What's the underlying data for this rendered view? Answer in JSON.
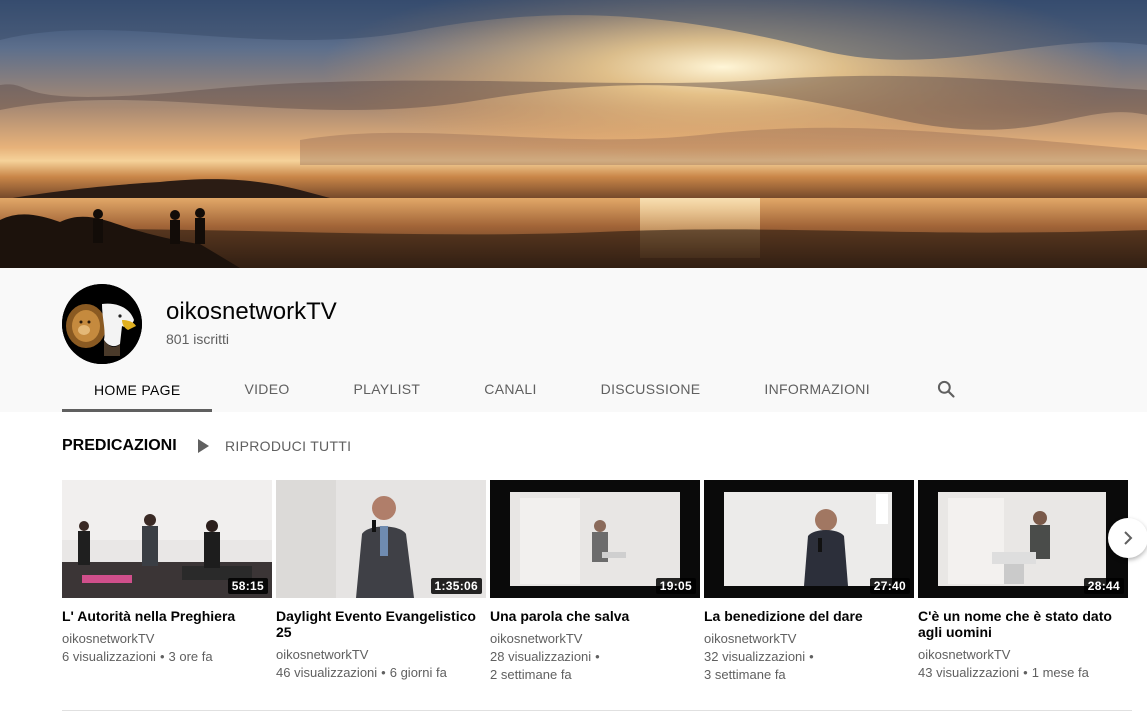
{
  "channel": {
    "name": "oikosnetworkTV",
    "subscribers": "801 iscritti"
  },
  "tabs": [
    {
      "label": "HOME PAGE"
    },
    {
      "label": "VIDEO"
    },
    {
      "label": "PLAYLIST"
    },
    {
      "label": "CANALI"
    },
    {
      "label": "DISCUSSIONE"
    },
    {
      "label": "INFORMAZIONI"
    }
  ],
  "active_tab": "HOME PAGE",
  "section": {
    "title": "PREDICAZIONI",
    "play_all": "RIPRODUCI TUTTI"
  },
  "videos": [
    {
      "title": "L' Autorità nella Preghiera",
      "duration": "58:15",
      "channel": "oikosnetworkTV",
      "views": "6 visualizzazioni",
      "age": "3 ore fa"
    },
    {
      "title": "Daylight Evento Evangelistico 25",
      "duration": "1:35:06",
      "channel": "oikosnetworkTV",
      "views": "46 visualizzazioni",
      "age": "6 giorni fa"
    },
    {
      "title": "Una parola che salva",
      "duration": "19:05",
      "channel": "oikosnetworkTV",
      "views": "28 visualizzazioni",
      "age": "2 settimane fa"
    },
    {
      "title": "La benedizione del dare",
      "duration": "27:40",
      "channel": "oikosnetworkTV",
      "views": "32 visualizzazioni",
      "age": "3 settimane fa"
    },
    {
      "title": "C'è un nome che è stato dato agli uomini",
      "duration": "28:44",
      "channel": "oikosnetworkTV",
      "views": "43 visualizzazioni",
      "age": "1 mese fa"
    }
  ],
  "icons": {
    "search": "search-icon",
    "play": "play-icon",
    "next": "chevron-right-icon"
  },
  "colors": {
    "secondary_text": "#606060",
    "header_bg": "#f9f9f9"
  }
}
